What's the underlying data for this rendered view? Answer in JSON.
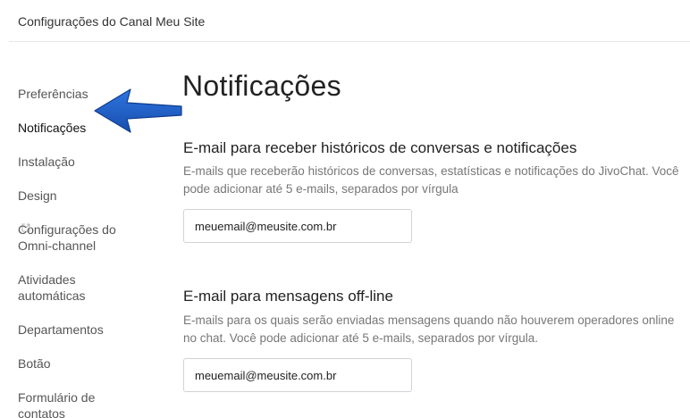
{
  "header": {
    "title": "Configurações do Canal Meu Site"
  },
  "sidebar": {
    "items": [
      {
        "label": "Preferências"
      },
      {
        "label": "Notificações",
        "active": true
      },
      {
        "label": "Instalação"
      },
      {
        "label": "Design",
        "icon": "external-link-icon"
      },
      {
        "label": "Configurações do\nOmni-channel"
      },
      {
        "label": "Atividades\nautomáticas"
      },
      {
        "label": "Departamentos"
      },
      {
        "label": "Botão"
      },
      {
        "label": "Formulário de\ncontatos"
      }
    ]
  },
  "annotation": {
    "icon": "arrow-left-icon",
    "color": "#1f5fc9"
  },
  "main": {
    "title": "Notificações",
    "sections": [
      {
        "title": "E-mail para receber históricos de conversas e notificações",
        "description": "E-mails que receberão históricos de conversas, estatísticas e notificações do JivoChat. Você pode adicionar até 5 e-mails, separados por vírgula",
        "value": "meuemail@meusite.com.br"
      },
      {
        "title": "E-mail para mensagens off-line",
        "description": "E-mails para os quais serão enviadas mensagens quando não houverem operadores online no chat. Você pode adicionar até 5 e-mails, separados por vírgula.",
        "value": "meuemail@meusite.com.br"
      }
    ]
  }
}
